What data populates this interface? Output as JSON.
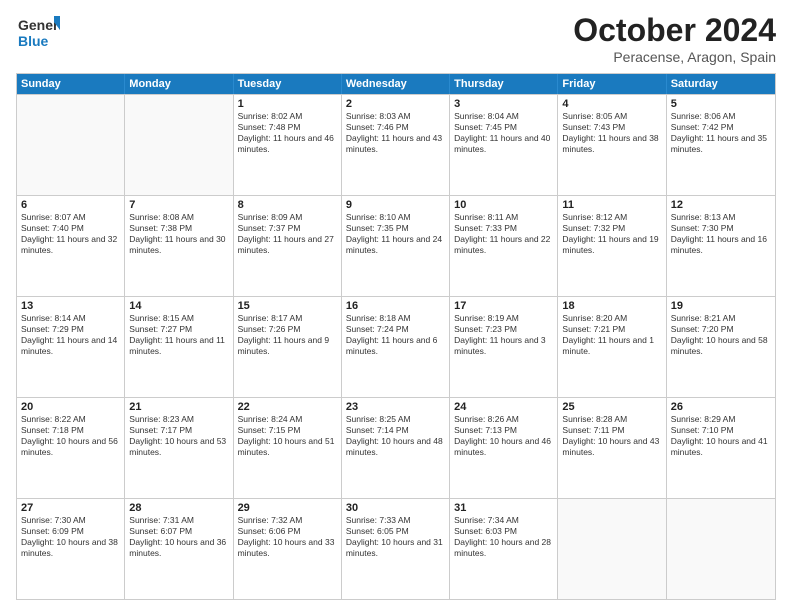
{
  "header": {
    "logo_general": "General",
    "logo_blue": "Blue",
    "month_title": "October 2024",
    "location": "Peracense, Aragon, Spain"
  },
  "weekdays": [
    "Sunday",
    "Monday",
    "Tuesday",
    "Wednesday",
    "Thursday",
    "Friday",
    "Saturday"
  ],
  "weeks": [
    [
      {
        "day": "",
        "text": ""
      },
      {
        "day": "",
        "text": ""
      },
      {
        "day": "1",
        "text": "Sunrise: 8:02 AM\nSunset: 7:48 PM\nDaylight: 11 hours and 46 minutes."
      },
      {
        "day": "2",
        "text": "Sunrise: 8:03 AM\nSunset: 7:46 PM\nDaylight: 11 hours and 43 minutes."
      },
      {
        "day": "3",
        "text": "Sunrise: 8:04 AM\nSunset: 7:45 PM\nDaylight: 11 hours and 40 minutes."
      },
      {
        "day": "4",
        "text": "Sunrise: 8:05 AM\nSunset: 7:43 PM\nDaylight: 11 hours and 38 minutes."
      },
      {
        "day": "5",
        "text": "Sunrise: 8:06 AM\nSunset: 7:42 PM\nDaylight: 11 hours and 35 minutes."
      }
    ],
    [
      {
        "day": "6",
        "text": "Sunrise: 8:07 AM\nSunset: 7:40 PM\nDaylight: 11 hours and 32 minutes."
      },
      {
        "day": "7",
        "text": "Sunrise: 8:08 AM\nSunset: 7:38 PM\nDaylight: 11 hours and 30 minutes."
      },
      {
        "day": "8",
        "text": "Sunrise: 8:09 AM\nSunset: 7:37 PM\nDaylight: 11 hours and 27 minutes."
      },
      {
        "day": "9",
        "text": "Sunrise: 8:10 AM\nSunset: 7:35 PM\nDaylight: 11 hours and 24 minutes."
      },
      {
        "day": "10",
        "text": "Sunrise: 8:11 AM\nSunset: 7:33 PM\nDaylight: 11 hours and 22 minutes."
      },
      {
        "day": "11",
        "text": "Sunrise: 8:12 AM\nSunset: 7:32 PM\nDaylight: 11 hours and 19 minutes."
      },
      {
        "day": "12",
        "text": "Sunrise: 8:13 AM\nSunset: 7:30 PM\nDaylight: 11 hours and 16 minutes."
      }
    ],
    [
      {
        "day": "13",
        "text": "Sunrise: 8:14 AM\nSunset: 7:29 PM\nDaylight: 11 hours and 14 minutes."
      },
      {
        "day": "14",
        "text": "Sunrise: 8:15 AM\nSunset: 7:27 PM\nDaylight: 11 hours and 11 minutes."
      },
      {
        "day": "15",
        "text": "Sunrise: 8:17 AM\nSunset: 7:26 PM\nDaylight: 11 hours and 9 minutes."
      },
      {
        "day": "16",
        "text": "Sunrise: 8:18 AM\nSunset: 7:24 PM\nDaylight: 11 hours and 6 minutes."
      },
      {
        "day": "17",
        "text": "Sunrise: 8:19 AM\nSunset: 7:23 PM\nDaylight: 11 hours and 3 minutes."
      },
      {
        "day": "18",
        "text": "Sunrise: 8:20 AM\nSunset: 7:21 PM\nDaylight: 11 hours and 1 minute."
      },
      {
        "day": "19",
        "text": "Sunrise: 8:21 AM\nSunset: 7:20 PM\nDaylight: 10 hours and 58 minutes."
      }
    ],
    [
      {
        "day": "20",
        "text": "Sunrise: 8:22 AM\nSunset: 7:18 PM\nDaylight: 10 hours and 56 minutes."
      },
      {
        "day": "21",
        "text": "Sunrise: 8:23 AM\nSunset: 7:17 PM\nDaylight: 10 hours and 53 minutes."
      },
      {
        "day": "22",
        "text": "Sunrise: 8:24 AM\nSunset: 7:15 PM\nDaylight: 10 hours and 51 minutes."
      },
      {
        "day": "23",
        "text": "Sunrise: 8:25 AM\nSunset: 7:14 PM\nDaylight: 10 hours and 48 minutes."
      },
      {
        "day": "24",
        "text": "Sunrise: 8:26 AM\nSunset: 7:13 PM\nDaylight: 10 hours and 46 minutes."
      },
      {
        "day": "25",
        "text": "Sunrise: 8:28 AM\nSunset: 7:11 PM\nDaylight: 10 hours and 43 minutes."
      },
      {
        "day": "26",
        "text": "Sunrise: 8:29 AM\nSunset: 7:10 PM\nDaylight: 10 hours and 41 minutes."
      }
    ],
    [
      {
        "day": "27",
        "text": "Sunrise: 7:30 AM\nSunset: 6:09 PM\nDaylight: 10 hours and 38 minutes."
      },
      {
        "day": "28",
        "text": "Sunrise: 7:31 AM\nSunset: 6:07 PM\nDaylight: 10 hours and 36 minutes."
      },
      {
        "day": "29",
        "text": "Sunrise: 7:32 AM\nSunset: 6:06 PM\nDaylight: 10 hours and 33 minutes."
      },
      {
        "day": "30",
        "text": "Sunrise: 7:33 AM\nSunset: 6:05 PM\nDaylight: 10 hours and 31 minutes."
      },
      {
        "day": "31",
        "text": "Sunrise: 7:34 AM\nSunset: 6:03 PM\nDaylight: 10 hours and 28 minutes."
      },
      {
        "day": "",
        "text": ""
      },
      {
        "day": "",
        "text": ""
      }
    ]
  ]
}
